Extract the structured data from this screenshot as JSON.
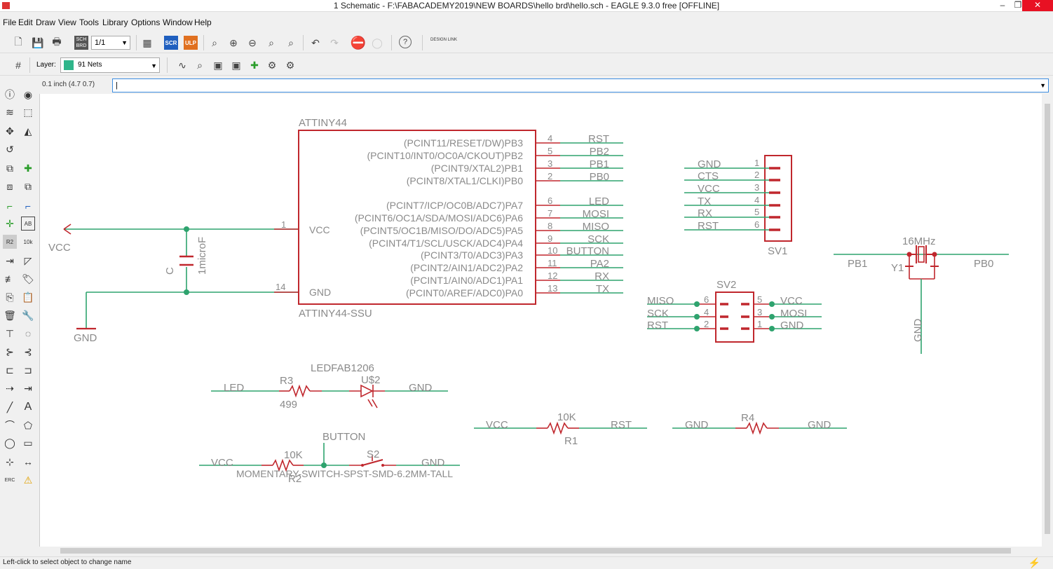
{
  "window": {
    "title": "1 Schematic - F:\\FABACADEMY2019\\NEW BOARDS\\hello brd\\hello.sch - EAGLE 9.3.0 free [OFFLINE]",
    "controls": {
      "minimize": "–",
      "restore": "❐",
      "close": "✕"
    }
  },
  "menu": [
    "File",
    "Edit",
    "Draw",
    "View",
    "Tools",
    "Library",
    "Options",
    "Window",
    "Help"
  ],
  "toolbar": {
    "sheet_combo": "1/1",
    "scr_label": "SCR",
    "ulp_label": "ULP",
    "sch_brd_label": "SCH BRD",
    "design_link_label": "DESIGN LINK",
    "help_label": "?"
  },
  "layerbar": {
    "layer_label": "Layer:",
    "layer_value": "91 Nets",
    "layer_color": "#2fb58a"
  },
  "coordbar": {
    "grid_readout": "0.1 inch (4.7 0.7)",
    "command_value": "|"
  },
  "sidebar": {
    "name_value_r2": "R2",
    "name_value_10k": "10k",
    "ab_label": "AB",
    "erc_label": "ERC"
  },
  "schematic": {
    "colors": {
      "net": "#2ea36e",
      "part": "#c0272d",
      "text": "#8a8a8a",
      "junction": "#2ea36e"
    },
    "attiny": {
      "name": "ATTINY44",
      "value": "ATTINY44-SSU",
      "right_pins": [
        {
          "desc": "(PCINT11/RESET/DW)PB3",
          "num": "4",
          "net": "RST"
        },
        {
          "desc": "(PCINT10/INT0/OC0A/CKOUT)PB2",
          "num": "5",
          "net": "PB2"
        },
        {
          "desc": "(PCINT9/XTAL2)PB1",
          "num": "3",
          "net": "PB1"
        },
        {
          "desc": "(PCINT8/XTAL1/CLKI)PB0",
          "num": "2",
          "net": "PB0"
        },
        {
          "desc": "(PCINT7/ICP/OC0B/ADC7)PA7",
          "num": "6",
          "net": "LED"
        },
        {
          "desc": "(PCINT6/OC1A/SDA/MOSI/ADC6)PA6",
          "num": "7",
          "net": "MOSI"
        },
        {
          "desc": "(PCINT5/OC1B/MISO/DO/ADC5)PA5",
          "num": "8",
          "net": "MISO"
        },
        {
          "desc": "(PCINT4/T1/SCL/USCK/ADC4)PA4",
          "num": "9",
          "net": "SCK"
        },
        {
          "desc": "(PCINT3/T0/ADC3)PA3",
          "num": "10",
          "net": "BUTTON"
        },
        {
          "desc": "(PCINT2/AIN1/ADC2)PA2",
          "num": "11",
          "net": "PA2"
        },
        {
          "desc": "(PCINT1/AIN0/ADC1)PA1",
          "num": "12",
          "net": "RX"
        },
        {
          "desc": "(PCINT0/AREF/ADC0)PA0",
          "num": "13",
          "net": "TX"
        }
      ],
      "vcc_pin": {
        "label": "VCC",
        "num": "1"
      },
      "gnd_pin": {
        "label": "GND",
        "num": "14"
      }
    },
    "vcc_supply": "VCC",
    "gnd_supply": "GND",
    "capacitor": {
      "name": "C",
      "value": "1microF"
    },
    "sv1": {
      "name": "SV1",
      "pins": [
        {
          "net": "GND",
          "num": "1"
        },
        {
          "net": "CTS",
          "num": "2"
        },
        {
          "net": "VCC",
          "num": "3"
        },
        {
          "net": "TX",
          "num": "4"
        },
        {
          "net": "RX",
          "num": "5"
        },
        {
          "net": "RST",
          "num": "6"
        }
      ]
    },
    "sv2": {
      "name": "SV2",
      "left": [
        {
          "net": "MISO",
          "num": "6"
        },
        {
          "net": "SCK",
          "num": "4"
        },
        {
          "net": "RST",
          "num": "2"
        }
      ],
      "right": [
        {
          "net": "VCC",
          "num": "5"
        },
        {
          "net": "MOSI",
          "num": "3"
        },
        {
          "net": "GND",
          "num": "1"
        }
      ]
    },
    "crystal": {
      "name": "Y1",
      "value": "16MHz",
      "left_net": "PB1",
      "right_net": "PB0",
      "gnd_net": "GND"
    },
    "led_row": {
      "left_net": "LED",
      "r_name": "R3",
      "r_value": "499",
      "led_type": "LEDFAB1206",
      "led_name": "U$2",
      "right_net": "GND"
    },
    "rst_row": {
      "left_net": "VCC",
      "r_value": "10K",
      "r_name": "R1",
      "right_net": "RST"
    },
    "r4_row": {
      "left_net": "GND",
      "r_name": "R4",
      "right_net": "GND"
    },
    "button_row": {
      "left_net": "VCC",
      "r_value": "10K",
      "r_name": "R2",
      "button_net": "BUTTON",
      "switch_name": "S2",
      "right_net": "GND",
      "switch_value": "MOMENTARY-SWITCH-SPST-SMD-6.2MM-TALL"
    }
  },
  "status": {
    "message": "Left-click to select object to change name"
  }
}
